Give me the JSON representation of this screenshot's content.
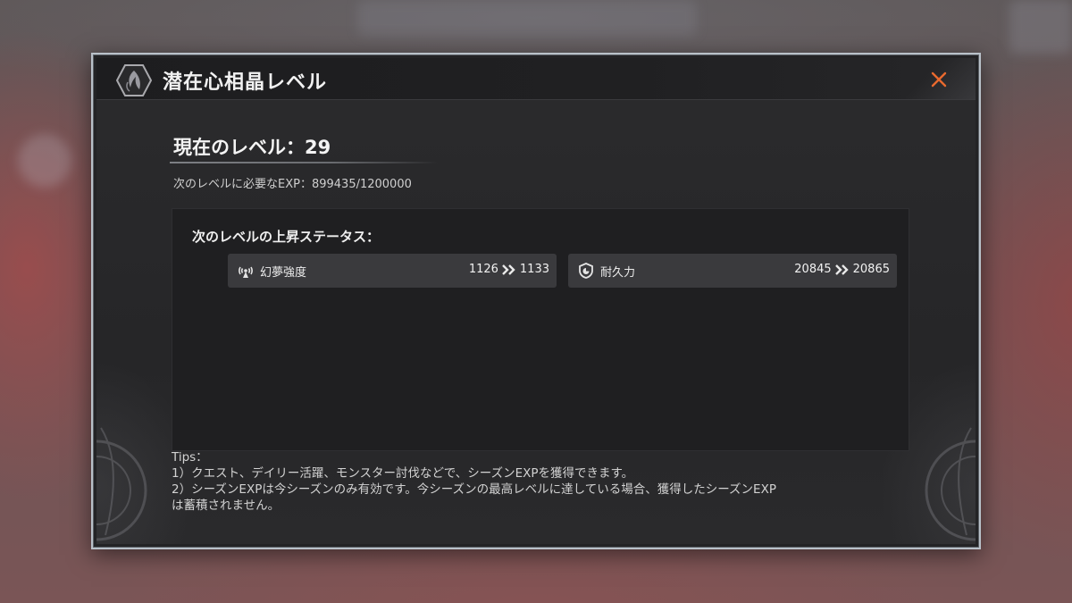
{
  "modal": {
    "title": "潜在心相晶レベル",
    "emblem_icon": "crystal-emblem-icon",
    "close_icon": "close-icon",
    "accent_color": "#e8692e"
  },
  "level": {
    "current_text": "現在のレベル：29",
    "exp_text": "次のレベルに必要なEXP：899435/1200000"
  },
  "stats": {
    "heading": "次のレベルの上昇ステータス：",
    "items": [
      {
        "icon": "radar-signal-icon",
        "label": "幻夢強度",
        "from": "1126",
        "to": "1133"
      },
      {
        "icon": "shield-icon",
        "label": "耐久力",
        "from": "20845",
        "to": "20865"
      }
    ]
  },
  "tips": {
    "heading": "Tips：",
    "lines": [
      "1）クエスト、デイリー活躍、モンスター討伐などで、シーズンEXPを獲得できます。",
      "2）シーズンEXPは今シーズンのみ有効です。今シーズンの最高レベルに達している場合、獲得したシーズンEXP",
      "は蓄積されません。"
    ]
  }
}
